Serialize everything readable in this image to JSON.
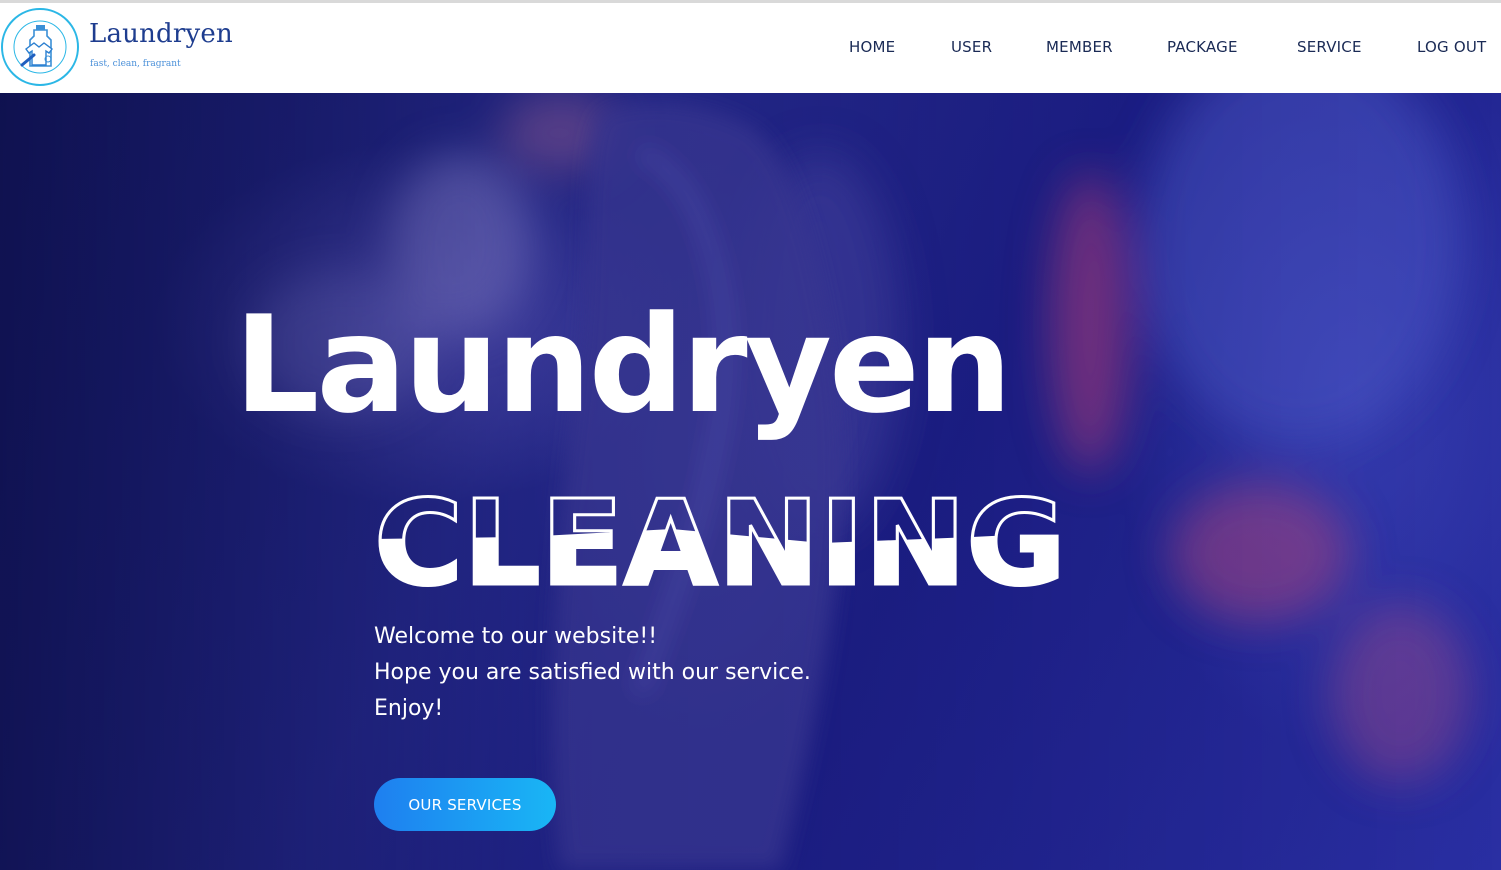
{
  "brand": {
    "name": "Laundryen",
    "tagline": "fast, clean, fragrant",
    "logo_icon": "spray-bottle-shirt-icon",
    "accent_color": "#2bb7e6"
  },
  "nav": {
    "items": [
      {
        "label": "HOME"
      },
      {
        "label": "USER"
      },
      {
        "label": "MEMBER"
      },
      {
        "label": "PACKAGE"
      },
      {
        "label": "SERVICE"
      },
      {
        "label": "LOG OUT"
      }
    ]
  },
  "hero": {
    "title": "Laundryen",
    "subtitle": "CLEANING",
    "welcome_lines": [
      "Welcome to our website!!",
      "Hope you are satisfied with our service.",
      "Enjoy!"
    ],
    "cta_label": "OUR SERVICES",
    "cta_colors": [
      "#1e7ff0",
      "#19b6f5"
    ],
    "overlay_color": "#1c1e84"
  }
}
